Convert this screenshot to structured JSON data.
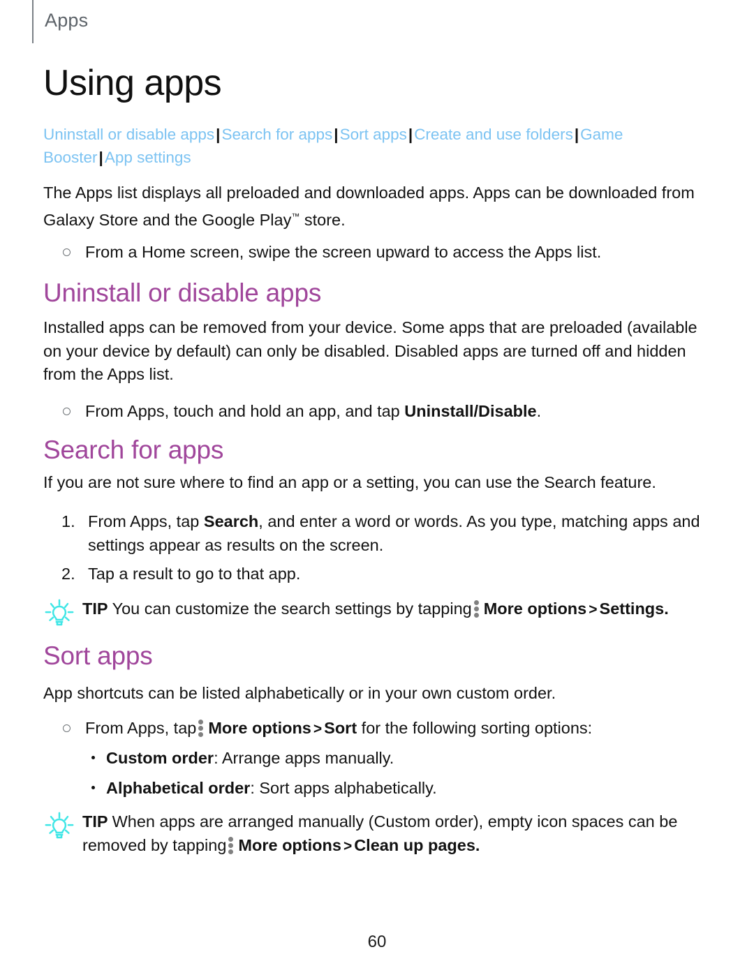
{
  "running_head": {
    "label": "Apps"
  },
  "page_title": "Using apps",
  "nav_links": {
    "items": [
      "Uninstall or disable apps",
      "Search for apps",
      "Sort apps",
      "Create and use folders",
      "Game Booster",
      "App settings"
    ],
    "separator": "|",
    "link_color": "#7cc3f2"
  },
  "intro": {
    "paragraph_part1": "The Apps list displays all preloaded and downloaded apps. Apps can be downloaded from Galaxy Store and the Google Play",
    "trademark": "™",
    "paragraph_part2": " store.",
    "bullet": "From a Home screen, swipe the screen upward to access the Apps list."
  },
  "section_uninstall": {
    "heading": "Uninstall or disable apps",
    "heading_color": "#a0469b",
    "paragraph": "Installed apps can be removed from your device. Some apps that are preloaded (available on your device by default) can only be disabled. Disabled apps are turned off and hidden from the Apps list.",
    "bullet_prefix": "From Apps, touch and hold an app, and tap ",
    "bullet_bold": "Uninstall/Disable",
    "bullet_suffix": "."
  },
  "section_search": {
    "heading": "Search for apps",
    "paragraph": "If you are not sure where to find an app or a setting, you can use the Search feature.",
    "steps": [
      {
        "number": "1.",
        "prefix": "From Apps, tap ",
        "bold": "Search",
        "suffix": ", and enter a word or words. As you type, matching apps and settings appear as results on the screen."
      },
      {
        "number": "2.",
        "prefix": "Tap a result to go to that app.",
        "bold": "",
        "suffix": ""
      }
    ],
    "tip": {
      "label": "TIP",
      "text_before": "You can customize the search settings by tapping",
      "icon": "more-options-icon",
      "menu_path_1": "More options",
      "chevron": ">",
      "menu_path_2": "Settings",
      "text_after": "."
    }
  },
  "section_sort": {
    "heading": "Sort apps",
    "paragraph": "App shortcuts can be listed alphabetically or in your own custom order.",
    "bullet": {
      "prefix": "From Apps, tap",
      "menu_path_1": "More options",
      "chevron": ">",
      "menu_path_2": "Sort",
      "suffix": " for the following sorting options:"
    },
    "options": [
      {
        "label": "Custom order",
        "description": ": Arrange apps manually."
      },
      {
        "label": "Alphabetical order",
        "description": ": Sort apps alphabetically."
      }
    ],
    "tip": {
      "label": "TIP",
      "text_before": "When apps are arranged manually (Custom order), empty icon spaces can be removed by tapping",
      "menu_path_1": "More options",
      "chevron": ">",
      "menu_path_2": "Clean up pages",
      "text_after": "."
    }
  },
  "footer": {
    "page_number": "60"
  },
  "icons": {
    "tip_bulb": "lightbulb-icon",
    "more_options": "more-options-icon",
    "bullet_marker": "hollow-circle-bullet-icon"
  },
  "colors": {
    "heading_purple": "#a0469b",
    "link_blue": "#7cc3f2",
    "tip_cyan": "#3fe6e6",
    "kebab_gray": "#808080"
  }
}
